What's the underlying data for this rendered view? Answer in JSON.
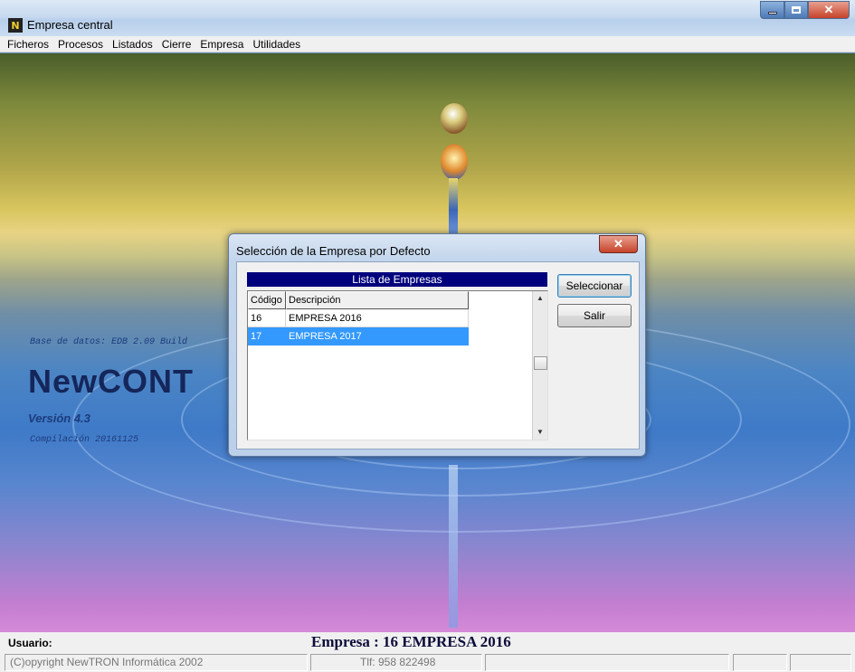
{
  "window": {
    "title": "Empresa central",
    "icon": "app-logo-icon"
  },
  "menu": [
    "Ficheros",
    "Procesos",
    "Listados",
    "Cierre",
    "Empresa",
    "Utilidades"
  ],
  "background": {
    "db_text": "Base de datos: EDB 2.09 Build",
    "brand": "NewCONT",
    "version": "Versión 4.3",
    "compile": "Compilación 20161125"
  },
  "dialog": {
    "title": "Selección de la Empresa por Defecto",
    "list_header": "Lista de Empresas",
    "columns": [
      "Código",
      "Descripción"
    ],
    "rows": [
      {
        "code": "16",
        "desc": "EMPRESA 2016",
        "selected": false
      },
      {
        "code": "17",
        "desc": "EMPRESA 2017",
        "selected": true
      }
    ],
    "buttons": {
      "select": "Seleccionar",
      "exit": "Salir"
    }
  },
  "status": {
    "user_label": "Usuario:",
    "empresa_line": "Empresa : 16 EMPRESA 2016",
    "copyright": "(C)opyright NewTRON Informática 2002",
    "phone": "Tlf: 958 822498"
  },
  "colors": {
    "list_header_bg": "#00007d",
    "selection": "#3399ff"
  }
}
